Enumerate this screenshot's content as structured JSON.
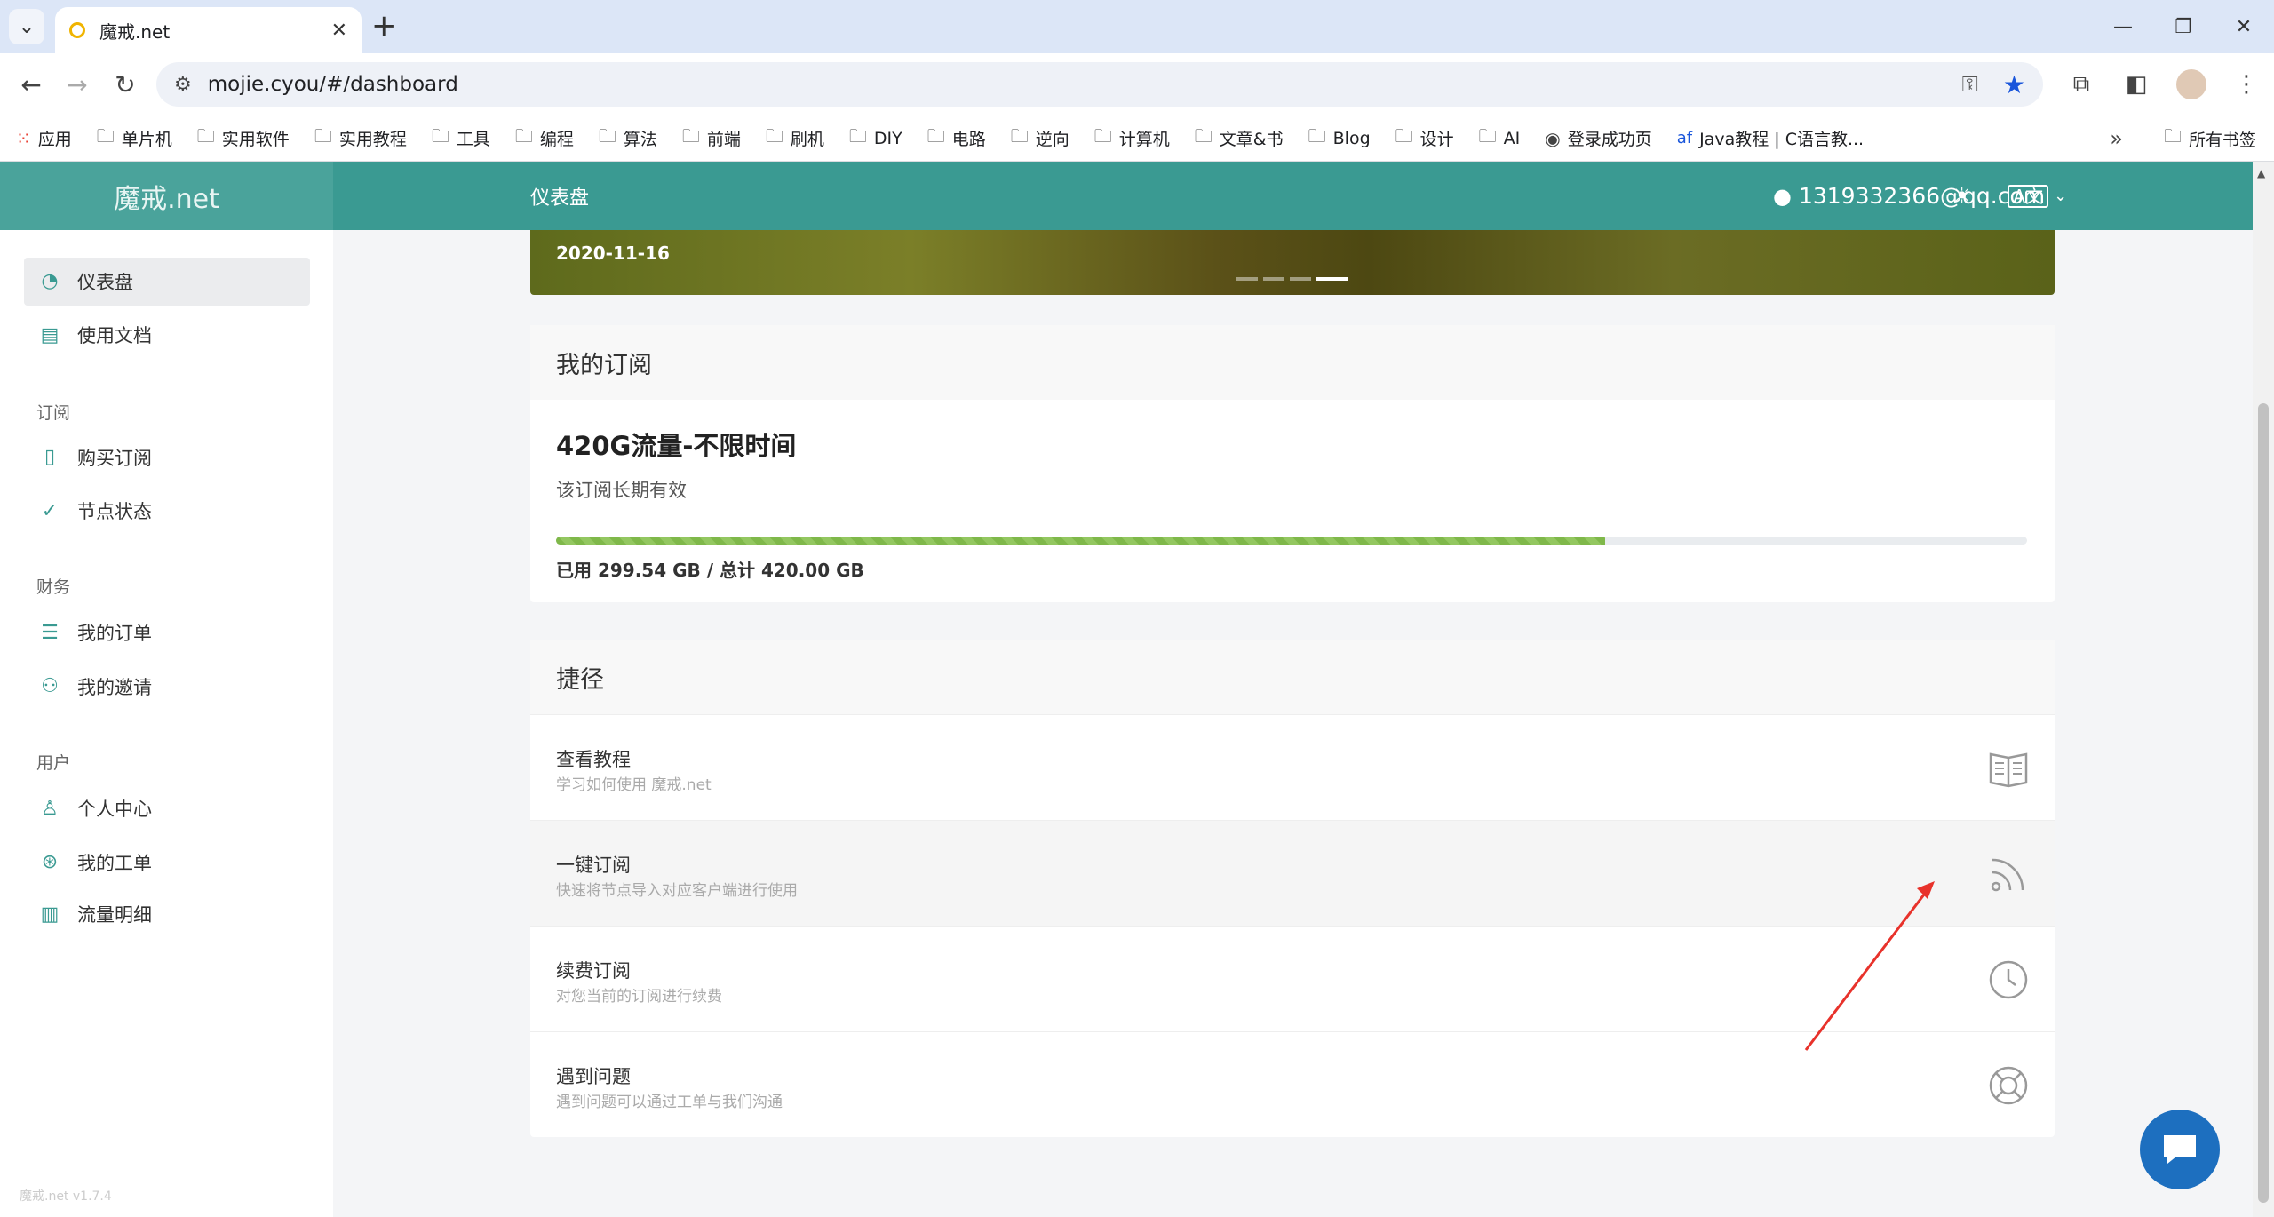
{
  "browser": {
    "tab_title": "魔戒.net",
    "url": "mojie.cyou/#/dashboard",
    "bookmarks": [
      {
        "label": "应用",
        "icon": "apps-icon"
      },
      {
        "label": "单片机",
        "icon": "folder-icon"
      },
      {
        "label": "实用软件",
        "icon": "folder-icon"
      },
      {
        "label": "实用教程",
        "icon": "folder-icon"
      },
      {
        "label": "工具",
        "icon": "folder-icon"
      },
      {
        "label": "编程",
        "icon": "folder-icon"
      },
      {
        "label": "算法",
        "icon": "folder-icon"
      },
      {
        "label": "前端",
        "icon": "folder-icon"
      },
      {
        "label": "刷机",
        "icon": "folder-icon"
      },
      {
        "label": "DIY",
        "icon": "folder-icon"
      },
      {
        "label": "电路",
        "icon": "folder-icon"
      },
      {
        "label": "逆向",
        "icon": "folder-icon"
      },
      {
        "label": "计算机",
        "icon": "folder-icon"
      },
      {
        "label": "文章&书",
        "icon": "folder-icon"
      },
      {
        "label": "Blog",
        "icon": "folder-icon"
      },
      {
        "label": "设计",
        "icon": "folder-icon"
      },
      {
        "label": "AI",
        "icon": "folder-icon"
      },
      {
        "label": "登录成功页",
        "icon": "globe-icon"
      },
      {
        "label": "Java教程 | C语言教...",
        "icon": "af-icon"
      }
    ],
    "all_bookmarks": "所有书签"
  },
  "header": {
    "brand": "魔戒.net",
    "page_title": "仪表盘",
    "user_email": "1319332366@qq.com"
  },
  "sidebar": {
    "items_top": [
      {
        "label": "仪表盘",
        "icon": "dashboard-icon",
        "active": true
      },
      {
        "label": "使用文档",
        "icon": "book-icon"
      }
    ],
    "groups": [
      {
        "title": "订阅",
        "items": [
          {
            "label": "购买订阅",
            "icon": "clipboard-icon"
          },
          {
            "label": "节点状态",
            "icon": "check-circle-icon"
          }
        ]
      },
      {
        "title": "财务",
        "items": [
          {
            "label": "我的订单",
            "icon": "list-icon"
          },
          {
            "label": "我的邀请",
            "icon": "users-icon"
          }
        ]
      },
      {
        "title": "用户",
        "items": [
          {
            "label": "个人中心",
            "icon": "user-icon"
          },
          {
            "label": "我的工单",
            "icon": "lifebuoy-icon"
          },
          {
            "label": "流量明细",
            "icon": "bar-chart-icon"
          }
        ]
      }
    ],
    "version": "魔戒.net v1.7.4"
  },
  "banner": {
    "date": "2020-11-16",
    "slides": 4,
    "active_slide": 4
  },
  "subscription": {
    "title": "我的订阅",
    "plan_name": "420G流量-不限时间",
    "validity": "该订阅长期有效",
    "used_fraction": 0.7132,
    "usage_text": "已用 299.54 GB / 总计 420.00 GB"
  },
  "shortcuts": {
    "title": "捷径",
    "items": [
      {
        "title": "查看教程",
        "desc": "学习如何使用 魔戒.net",
        "icon": "book-open-icon"
      },
      {
        "title": "一键订阅",
        "desc": "快速将节点导入对应客户端进行使用",
        "icon": "rss-icon"
      },
      {
        "title": "续费订阅",
        "desc": "对您当前的订阅进行续费",
        "icon": "clock-icon"
      },
      {
        "title": "遇到问题",
        "desc": "遇到问题可以通过工单与我们沟通",
        "icon": "lifebuoy-icon"
      }
    ]
  },
  "colors": {
    "header": "#3a9a92",
    "brand_bg": "#4aa39b",
    "progress": "#7fb84a",
    "chat_button": "#1d6fbf",
    "annotation_arrow": "#e8322b"
  }
}
